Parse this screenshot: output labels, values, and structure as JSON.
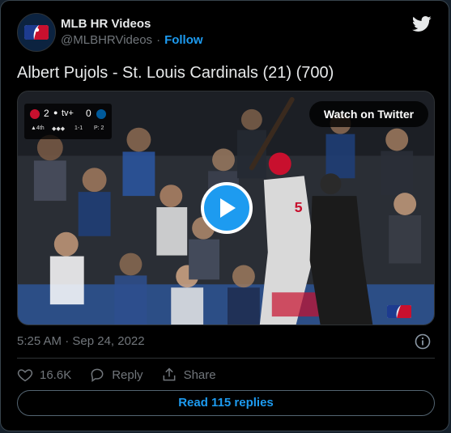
{
  "author": {
    "name": "MLB HR Videos",
    "handle": "@MLBHRVideos",
    "separator": "·",
    "follow_label": "Follow"
  },
  "tweet": {
    "text": "Albert Pujols - St. Louis Cardinals (21) (700)",
    "timestamp": "5:25 AM · Sep 24, 2022"
  },
  "video": {
    "watch_label": "Watch on Twitter",
    "scorebug": {
      "away_score": "2",
      "network": "tv+",
      "home_score": "0",
      "inning": "▲4th",
      "count": "1-1",
      "pitch_label": "P: 2"
    }
  },
  "actions": {
    "likes": "16.6K",
    "reply_label": "Reply",
    "share_label": "Share"
  },
  "read_replies_label": "Read 115 replies",
  "colors": {
    "accent": "#1d9bf0",
    "background": "#000000",
    "muted": "#71767b",
    "border": "#2f3336"
  }
}
